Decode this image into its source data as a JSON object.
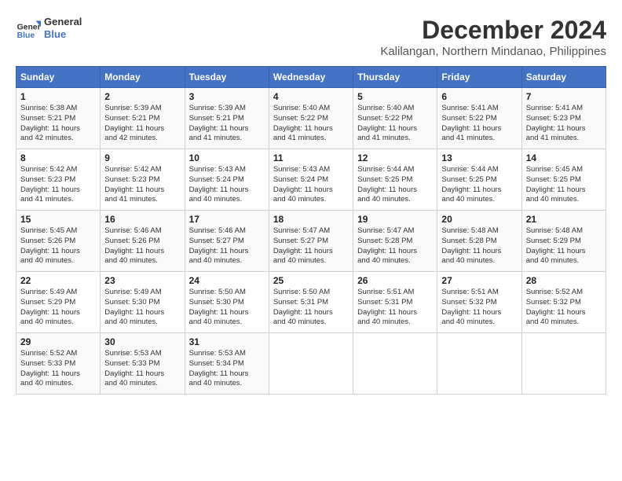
{
  "header": {
    "logo_line1": "General",
    "logo_line2": "Blue",
    "month": "December 2024",
    "location": "Kalilangan, Northern Mindanao, Philippines"
  },
  "weekdays": [
    "Sunday",
    "Monday",
    "Tuesday",
    "Wednesday",
    "Thursday",
    "Friday",
    "Saturday"
  ],
  "weeks": [
    [
      {
        "day": "1",
        "info": "Sunrise: 5:38 AM\nSunset: 5:21 PM\nDaylight: 11 hours\nand 42 minutes."
      },
      {
        "day": "2",
        "info": "Sunrise: 5:39 AM\nSunset: 5:21 PM\nDaylight: 11 hours\nand 42 minutes."
      },
      {
        "day": "3",
        "info": "Sunrise: 5:39 AM\nSunset: 5:21 PM\nDaylight: 11 hours\nand 41 minutes."
      },
      {
        "day": "4",
        "info": "Sunrise: 5:40 AM\nSunset: 5:22 PM\nDaylight: 11 hours\nand 41 minutes."
      },
      {
        "day": "5",
        "info": "Sunrise: 5:40 AM\nSunset: 5:22 PM\nDaylight: 11 hours\nand 41 minutes."
      },
      {
        "day": "6",
        "info": "Sunrise: 5:41 AM\nSunset: 5:22 PM\nDaylight: 11 hours\nand 41 minutes."
      },
      {
        "day": "7",
        "info": "Sunrise: 5:41 AM\nSunset: 5:23 PM\nDaylight: 11 hours\nand 41 minutes."
      }
    ],
    [
      {
        "day": "8",
        "info": "Sunrise: 5:42 AM\nSunset: 5:23 PM\nDaylight: 11 hours\nand 41 minutes."
      },
      {
        "day": "9",
        "info": "Sunrise: 5:42 AM\nSunset: 5:23 PM\nDaylight: 11 hours\nand 41 minutes."
      },
      {
        "day": "10",
        "info": "Sunrise: 5:43 AM\nSunset: 5:24 PM\nDaylight: 11 hours\nand 40 minutes."
      },
      {
        "day": "11",
        "info": "Sunrise: 5:43 AM\nSunset: 5:24 PM\nDaylight: 11 hours\nand 40 minutes."
      },
      {
        "day": "12",
        "info": "Sunrise: 5:44 AM\nSunset: 5:25 PM\nDaylight: 11 hours\nand 40 minutes."
      },
      {
        "day": "13",
        "info": "Sunrise: 5:44 AM\nSunset: 5:25 PM\nDaylight: 11 hours\nand 40 minutes."
      },
      {
        "day": "14",
        "info": "Sunrise: 5:45 AM\nSunset: 5:25 PM\nDaylight: 11 hours\nand 40 minutes."
      }
    ],
    [
      {
        "day": "15",
        "info": "Sunrise: 5:45 AM\nSunset: 5:26 PM\nDaylight: 11 hours\nand 40 minutes."
      },
      {
        "day": "16",
        "info": "Sunrise: 5:46 AM\nSunset: 5:26 PM\nDaylight: 11 hours\nand 40 minutes."
      },
      {
        "day": "17",
        "info": "Sunrise: 5:46 AM\nSunset: 5:27 PM\nDaylight: 11 hours\nand 40 minutes."
      },
      {
        "day": "18",
        "info": "Sunrise: 5:47 AM\nSunset: 5:27 PM\nDaylight: 11 hours\nand 40 minutes."
      },
      {
        "day": "19",
        "info": "Sunrise: 5:47 AM\nSunset: 5:28 PM\nDaylight: 11 hours\nand 40 minutes."
      },
      {
        "day": "20",
        "info": "Sunrise: 5:48 AM\nSunset: 5:28 PM\nDaylight: 11 hours\nand 40 minutes."
      },
      {
        "day": "21",
        "info": "Sunrise: 5:48 AM\nSunset: 5:29 PM\nDaylight: 11 hours\nand 40 minutes."
      }
    ],
    [
      {
        "day": "22",
        "info": "Sunrise: 5:49 AM\nSunset: 5:29 PM\nDaylight: 11 hours\nand 40 minutes."
      },
      {
        "day": "23",
        "info": "Sunrise: 5:49 AM\nSunset: 5:30 PM\nDaylight: 11 hours\nand 40 minutes."
      },
      {
        "day": "24",
        "info": "Sunrise: 5:50 AM\nSunset: 5:30 PM\nDaylight: 11 hours\nand 40 minutes."
      },
      {
        "day": "25",
        "info": "Sunrise: 5:50 AM\nSunset: 5:31 PM\nDaylight: 11 hours\nand 40 minutes."
      },
      {
        "day": "26",
        "info": "Sunrise: 5:51 AM\nSunset: 5:31 PM\nDaylight: 11 hours\nand 40 minutes."
      },
      {
        "day": "27",
        "info": "Sunrise: 5:51 AM\nSunset: 5:32 PM\nDaylight: 11 hours\nand 40 minutes."
      },
      {
        "day": "28",
        "info": "Sunrise: 5:52 AM\nSunset: 5:32 PM\nDaylight: 11 hours\nand 40 minutes."
      }
    ],
    [
      {
        "day": "29",
        "info": "Sunrise: 5:52 AM\nSunset: 5:33 PM\nDaylight: 11 hours\nand 40 minutes."
      },
      {
        "day": "30",
        "info": "Sunrise: 5:53 AM\nSunset: 5:33 PM\nDaylight: 11 hours\nand 40 minutes."
      },
      {
        "day": "31",
        "info": "Sunrise: 5:53 AM\nSunset: 5:34 PM\nDaylight: 11 hours\nand 40 minutes."
      },
      {
        "day": "",
        "info": ""
      },
      {
        "day": "",
        "info": ""
      },
      {
        "day": "",
        "info": ""
      },
      {
        "day": "",
        "info": ""
      }
    ]
  ]
}
